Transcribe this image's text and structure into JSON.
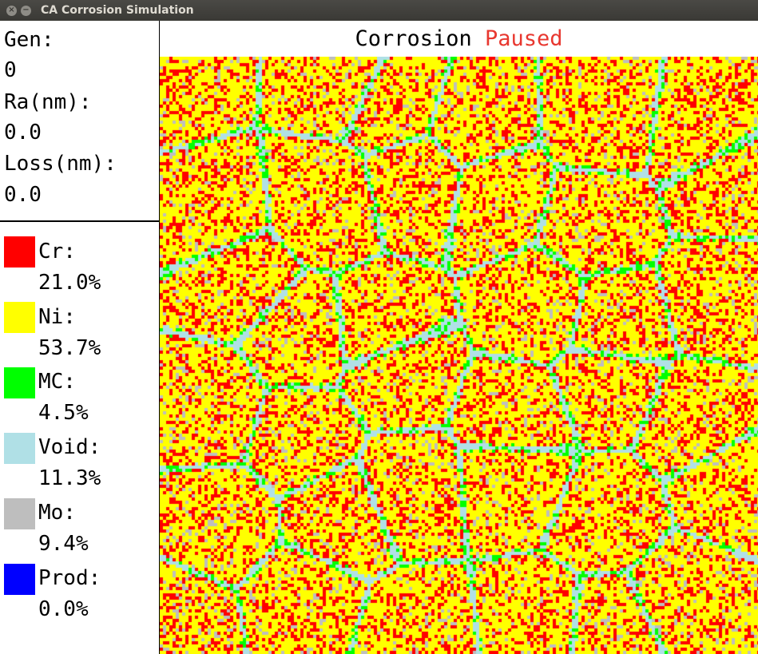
{
  "window": {
    "title": "CA Corrosion Simulation"
  },
  "stats": {
    "gen_label": "Gen:",
    "gen_value": "0",
    "ra_label": "Ra(nm):",
    "ra_value": "0.0",
    "loss_label": "Loss(nm):",
    "loss_value": "0.0"
  },
  "legend": [
    {
      "label": "Cr:",
      "value": "21.0%",
      "color": "#ff0000"
    },
    {
      "label": "Ni:",
      "value": "53.7%",
      "color": "#ffff00"
    },
    {
      "label": "MC:",
      "value": "4.5%",
      "color": "#00ff00"
    },
    {
      "label": "Void:",
      "value": "11.3%",
      "color": "#b0e0e6"
    },
    {
      "label": "Mo:",
      "value": "9.4%",
      "color": "#bebebe"
    },
    {
      "label": "Prod:",
      "value": "0.0%",
      "color": "#0000ff"
    }
  ],
  "simulation": {
    "title_main": "Corrosion",
    "title_state": "Paused"
  }
}
